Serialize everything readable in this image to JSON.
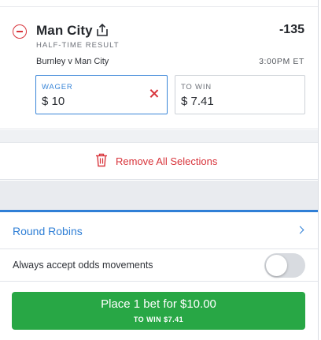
{
  "selection": {
    "team": "Man City",
    "odds": "-135",
    "market": "HALF-TIME RESULT",
    "match": "Burnley v Man City",
    "time": "3:00PM ET",
    "icons": {
      "remove": "minus-circle-icon",
      "share": "share-icon",
      "clear": "close-icon"
    }
  },
  "wager": {
    "label": "WAGER",
    "value": "$ 10"
  },
  "to_win": {
    "label": "TO WIN",
    "value": "$ 7.41"
  },
  "remove_all": {
    "label": "Remove All Selections",
    "icon": "trash-icon"
  },
  "round_robins": {
    "label": "Round Robins",
    "icon": "chevron-right-icon"
  },
  "odds_movement": {
    "label": "Always accept odds movements",
    "enabled": false
  },
  "place_bet": {
    "label": "Place 1 bet for $10.00",
    "sub_label": "TO WIN $7.41"
  },
  "colors": {
    "accent_blue": "#2f7fd6",
    "danger_red": "#d8343b",
    "place_green": "#28a745",
    "divider_gray": "#e9ebef"
  }
}
